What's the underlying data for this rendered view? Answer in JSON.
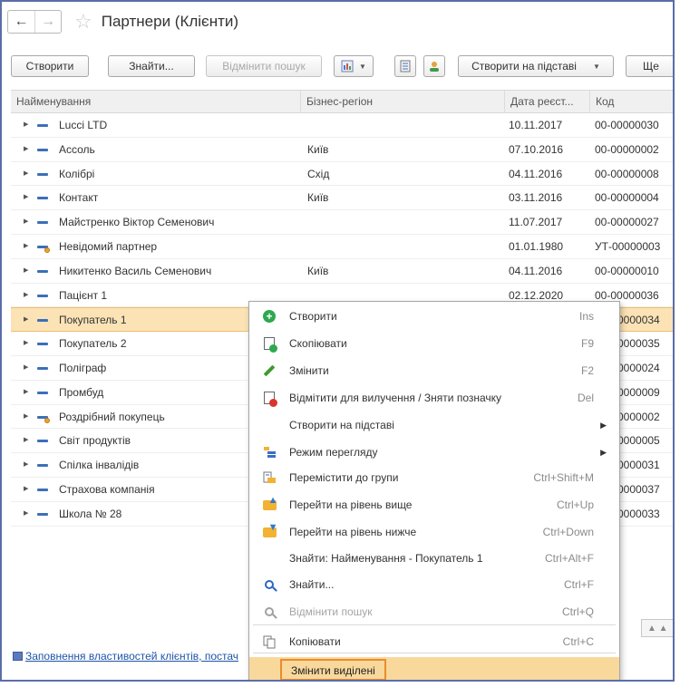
{
  "window": {
    "title": "Партнери (Клієнти)"
  },
  "nav": {
    "back": "←",
    "forward": "→",
    "star": "☆"
  },
  "toolbar": {
    "create": "Створити",
    "find": "Знайти...",
    "cancel_search": "Відмінити пошук",
    "create_based": "Створити на підставі",
    "more": "Ще",
    "dropdown_arrow": "▼"
  },
  "table": {
    "columns": [
      "Найменування",
      "Бізнес-регіон",
      "Дата реєст...",
      "Код"
    ],
    "rows": [
      {
        "name": "Lucci LTD",
        "region": "",
        "date": "10.11.2017",
        "code": "00-00000030",
        "icon": "dash"
      },
      {
        "name": "Ассоль",
        "region": "Київ",
        "date": "07.10.2016",
        "code": "00-00000002",
        "icon": "dash"
      },
      {
        "name": "Колібрі",
        "region": "Схід",
        "date": "04.11.2016",
        "code": "00-00000008",
        "icon": "dash"
      },
      {
        "name": "Контакт",
        "region": "Київ",
        "date": "03.11.2016",
        "code": "00-00000004",
        "icon": "dash"
      },
      {
        "name": "Майстренко Віктор Семенович",
        "region": "",
        "date": "11.07.2017",
        "code": "00-00000027",
        "icon": "dash"
      },
      {
        "name": "Невідомий партнер",
        "region": "",
        "date": "01.01.1980",
        "code": "УТ-00000003",
        "icon": "dash-dot"
      },
      {
        "name": "Никитенко Василь Семенович",
        "region": "Київ",
        "date": "04.11.2016",
        "code": "00-00000010",
        "icon": "dash"
      },
      {
        "name": "Пацієнт 1",
        "region": "",
        "date": "02.12.2020",
        "code": "00-00000036",
        "icon": "dash"
      },
      {
        "name": "Покупатель 1",
        "region": "",
        "date": "",
        "code": "0000034",
        "icon": "dash",
        "selected": true
      },
      {
        "name": "Покупатель 2",
        "region": "",
        "date": "",
        "code": "0000035",
        "icon": "dash"
      },
      {
        "name": "Поліграф",
        "region": "",
        "date": "",
        "code": "0000024",
        "icon": "dash"
      },
      {
        "name": "Промбуд",
        "region": "",
        "date": "",
        "code": "0000009",
        "icon": "dash"
      },
      {
        "name": "Роздрібний покупець",
        "region": "",
        "date": "",
        "code": "0000002",
        "icon": "dash-dot"
      },
      {
        "name": "Світ продуктів",
        "region": "",
        "date": "",
        "code": "0000005",
        "icon": "dash"
      },
      {
        "name": "Спілка інвалідів",
        "region": "",
        "date": "",
        "code": "0000031",
        "icon": "dash"
      },
      {
        "name": "Страхова компанія",
        "region": "",
        "date": "",
        "code": "0000037",
        "icon": "dash"
      },
      {
        "name": "Школа № 28",
        "region": "",
        "date": "",
        "code": "0000033",
        "icon": "dash"
      }
    ]
  },
  "footer": {
    "link": "Заповнення властивостей клієнтів, постач"
  },
  "context_menu": {
    "items": [
      {
        "label": "Створити",
        "key": "Ins",
        "icon": "plus-icon"
      },
      {
        "label": "Скопіювати",
        "key": "F9",
        "icon": "copy-doc-icon"
      },
      {
        "label": "Змінити",
        "key": "F2",
        "icon": "pencil-icon"
      },
      {
        "label": "Відмітити для вилучення / Зняти позначку",
        "key": "Del",
        "icon": "delete-mark-icon"
      },
      {
        "label": "Створити на підставі",
        "key": "",
        "icon": "",
        "submenu": "▶"
      },
      {
        "label": "Режим перегляду",
        "key": "",
        "icon": "view-mode-icon",
        "submenu": "▶"
      },
      {
        "label": "Перемістити до групи",
        "key": "Ctrl+Shift+M",
        "icon": "move-group-icon"
      },
      {
        "label": "Перейти на рівень вище",
        "key": "Ctrl+Up",
        "icon": "level-up-icon"
      },
      {
        "label": "Перейти на рівень нижче",
        "key": "Ctrl+Down",
        "icon": "level-down-icon"
      },
      {
        "label": "Знайти: Найменування - Покупатель 1",
        "key": "Ctrl+Alt+F",
        "icon": ""
      },
      {
        "label": "Знайти...",
        "key": "Ctrl+F",
        "icon": "search-icon"
      },
      {
        "label": "Відмінити пошук",
        "key": "Ctrl+Q",
        "icon": "cancel-search-icon",
        "disabled": true
      },
      {
        "label": "Копіювати",
        "key": "Ctrl+C",
        "icon": "copy-icon"
      },
      {
        "label": "Змінити виділені",
        "key": "",
        "icon": "",
        "highlighted": true
      }
    ]
  }
}
